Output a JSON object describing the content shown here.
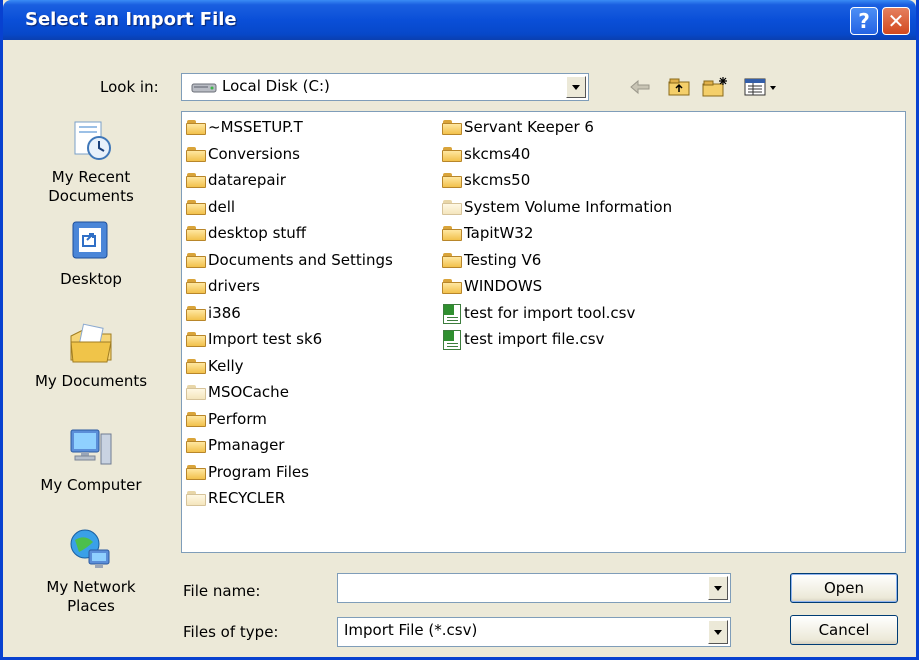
{
  "window": {
    "title": "Select an Import File",
    "help_glyph": "?",
    "close_glyph": "✕"
  },
  "lookin": {
    "label": "Look in:",
    "value": "Local Disk (C:)",
    "icon": "hard-drive-icon"
  },
  "toolbar": {
    "icons": [
      "back-arrow-icon",
      "up-folder-icon",
      "new-folder-icon",
      "view-menu-icon"
    ]
  },
  "places": [
    {
      "label": "My Recent Documents",
      "line1": "My Recent",
      "line2": "Documents",
      "icon": "recent-documents-icon"
    },
    {
      "label": "Desktop",
      "icon": "desktop-icon"
    },
    {
      "label": "My Documents",
      "icon": "my-documents-icon"
    },
    {
      "label": "My Computer",
      "icon": "my-computer-icon"
    },
    {
      "label": "My Network Places",
      "line1": "My Network",
      "line2": "Places",
      "icon": "network-places-icon"
    }
  ],
  "files": {
    "col1": [
      {
        "name": "~MSSETUP.T",
        "type": "folder"
      },
      {
        "name": "Conversions",
        "type": "folder"
      },
      {
        "name": "datarepair",
        "type": "folder"
      },
      {
        "name": "dell",
        "type": "folder"
      },
      {
        "name": "desktop stuff",
        "type": "folder"
      },
      {
        "name": "Documents and Settings",
        "type": "folder"
      },
      {
        "name": "drivers",
        "type": "folder"
      },
      {
        "name": "i386",
        "type": "folder"
      },
      {
        "name": "Import test sk6",
        "type": "folder"
      },
      {
        "name": "Kelly",
        "type": "folder"
      },
      {
        "name": "MSOCache",
        "type": "folder-hidden"
      },
      {
        "name": "Perform",
        "type": "folder"
      },
      {
        "name": "Pmanager",
        "type": "folder"
      },
      {
        "name": "Program Files",
        "type": "folder"
      },
      {
        "name": "RECYCLER",
        "type": "folder-hidden"
      }
    ],
    "col2": [
      {
        "name": "Servant Keeper 6",
        "type": "folder"
      },
      {
        "name": "skcms40",
        "type": "folder"
      },
      {
        "name": "skcms50",
        "type": "folder"
      },
      {
        "name": "System Volume Information",
        "type": "folder-hidden"
      },
      {
        "name": "TapitW32",
        "type": "folder"
      },
      {
        "name": "Testing V6",
        "type": "folder"
      },
      {
        "name": "WINDOWS",
        "type": "folder"
      },
      {
        "name": "test for import tool.csv",
        "type": "csv"
      },
      {
        "name": "test import file.csv",
        "type": "csv"
      }
    ]
  },
  "filename": {
    "label": "File name:",
    "value": ""
  },
  "filetype": {
    "label": "Files of type:",
    "value": "Import File (*.csv)"
  },
  "buttons": {
    "open": "Open",
    "cancel": "Cancel"
  },
  "colors": {
    "titlebar": "#0a4fd8",
    "dialog_bg": "#ece9d8",
    "close_button": "#d2491f"
  }
}
